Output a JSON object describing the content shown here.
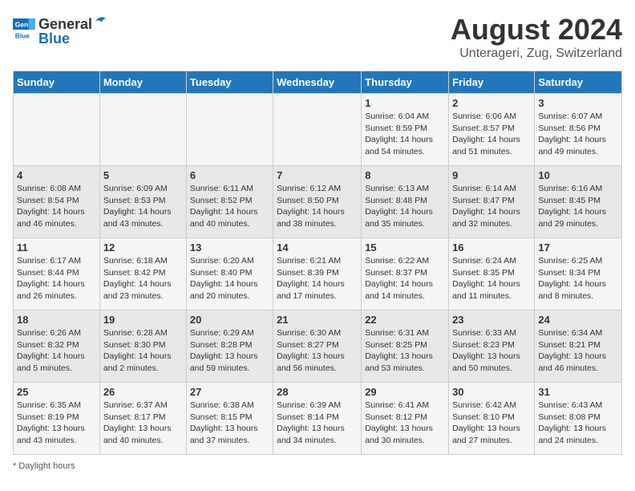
{
  "header": {
    "logo_general": "General",
    "logo_blue": "Blue",
    "month_title": "August 2024",
    "location": "Unterageri, Zug, Switzerland"
  },
  "days_of_week": [
    "Sunday",
    "Monday",
    "Tuesday",
    "Wednesday",
    "Thursday",
    "Friday",
    "Saturday"
  ],
  "weeks": [
    [
      {
        "day": "",
        "info": ""
      },
      {
        "day": "",
        "info": ""
      },
      {
        "day": "",
        "info": ""
      },
      {
        "day": "",
        "info": ""
      },
      {
        "day": "1",
        "info": "Sunrise: 6:04 AM\nSunset: 8:59 PM\nDaylight: 14 hours and 54 minutes."
      },
      {
        "day": "2",
        "info": "Sunrise: 6:06 AM\nSunset: 8:57 PM\nDaylight: 14 hours and 51 minutes."
      },
      {
        "day": "3",
        "info": "Sunrise: 6:07 AM\nSunset: 8:56 PM\nDaylight: 14 hours and 49 minutes."
      }
    ],
    [
      {
        "day": "4",
        "info": "Sunrise: 6:08 AM\nSunset: 8:54 PM\nDaylight: 14 hours and 46 minutes."
      },
      {
        "day": "5",
        "info": "Sunrise: 6:09 AM\nSunset: 8:53 PM\nDaylight: 14 hours and 43 minutes."
      },
      {
        "day": "6",
        "info": "Sunrise: 6:11 AM\nSunset: 8:52 PM\nDaylight: 14 hours and 40 minutes."
      },
      {
        "day": "7",
        "info": "Sunrise: 6:12 AM\nSunset: 8:50 PM\nDaylight: 14 hours and 38 minutes."
      },
      {
        "day": "8",
        "info": "Sunrise: 6:13 AM\nSunset: 8:48 PM\nDaylight: 14 hours and 35 minutes."
      },
      {
        "day": "9",
        "info": "Sunrise: 6:14 AM\nSunset: 8:47 PM\nDaylight: 14 hours and 32 minutes."
      },
      {
        "day": "10",
        "info": "Sunrise: 6:16 AM\nSunset: 8:45 PM\nDaylight: 14 hours and 29 minutes."
      }
    ],
    [
      {
        "day": "11",
        "info": "Sunrise: 6:17 AM\nSunset: 8:44 PM\nDaylight: 14 hours and 26 minutes."
      },
      {
        "day": "12",
        "info": "Sunrise: 6:18 AM\nSunset: 8:42 PM\nDaylight: 14 hours and 23 minutes."
      },
      {
        "day": "13",
        "info": "Sunrise: 6:20 AM\nSunset: 8:40 PM\nDaylight: 14 hours and 20 minutes."
      },
      {
        "day": "14",
        "info": "Sunrise: 6:21 AM\nSunset: 8:39 PM\nDaylight: 14 hours and 17 minutes."
      },
      {
        "day": "15",
        "info": "Sunrise: 6:22 AM\nSunset: 8:37 PM\nDaylight: 14 hours and 14 minutes."
      },
      {
        "day": "16",
        "info": "Sunrise: 6:24 AM\nSunset: 8:35 PM\nDaylight: 14 hours and 11 minutes."
      },
      {
        "day": "17",
        "info": "Sunrise: 6:25 AM\nSunset: 8:34 PM\nDaylight: 14 hours and 8 minutes."
      }
    ],
    [
      {
        "day": "18",
        "info": "Sunrise: 6:26 AM\nSunset: 8:32 PM\nDaylight: 14 hours and 5 minutes."
      },
      {
        "day": "19",
        "info": "Sunrise: 6:28 AM\nSunset: 8:30 PM\nDaylight: 14 hours and 2 minutes."
      },
      {
        "day": "20",
        "info": "Sunrise: 6:29 AM\nSunset: 8:28 PM\nDaylight: 13 hours and 59 minutes."
      },
      {
        "day": "21",
        "info": "Sunrise: 6:30 AM\nSunset: 8:27 PM\nDaylight: 13 hours and 56 minutes."
      },
      {
        "day": "22",
        "info": "Sunrise: 6:31 AM\nSunset: 8:25 PM\nDaylight: 13 hours and 53 minutes."
      },
      {
        "day": "23",
        "info": "Sunrise: 6:33 AM\nSunset: 8:23 PM\nDaylight: 13 hours and 50 minutes."
      },
      {
        "day": "24",
        "info": "Sunrise: 6:34 AM\nSunset: 8:21 PM\nDaylight: 13 hours and 46 minutes."
      }
    ],
    [
      {
        "day": "25",
        "info": "Sunrise: 6:35 AM\nSunset: 8:19 PM\nDaylight: 13 hours and 43 minutes."
      },
      {
        "day": "26",
        "info": "Sunrise: 6:37 AM\nSunset: 8:17 PM\nDaylight: 13 hours and 40 minutes."
      },
      {
        "day": "27",
        "info": "Sunrise: 6:38 AM\nSunset: 8:15 PM\nDaylight: 13 hours and 37 minutes."
      },
      {
        "day": "28",
        "info": "Sunrise: 6:39 AM\nSunset: 8:14 PM\nDaylight: 13 hours and 34 minutes."
      },
      {
        "day": "29",
        "info": "Sunrise: 6:41 AM\nSunset: 8:12 PM\nDaylight: 13 hours and 30 minutes."
      },
      {
        "day": "30",
        "info": "Sunrise: 6:42 AM\nSunset: 8:10 PM\nDaylight: 13 hours and 27 minutes."
      },
      {
        "day": "31",
        "info": "Sunrise: 6:43 AM\nSunset: 8:08 PM\nDaylight: 13 hours and 24 minutes."
      }
    ]
  ],
  "footer": {
    "note": "Daylight hours"
  }
}
